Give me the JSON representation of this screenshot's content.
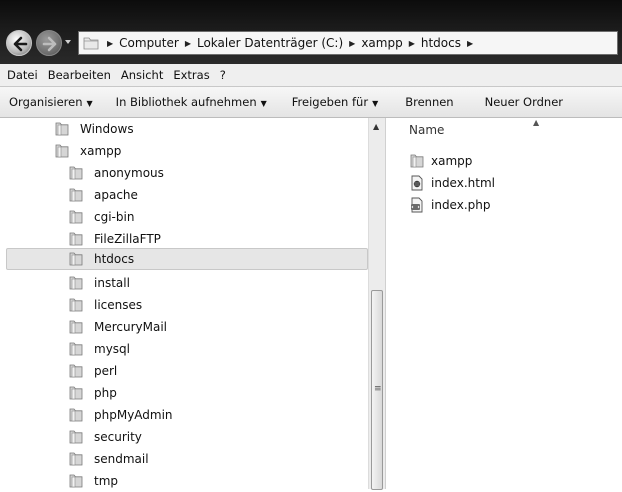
{
  "address_bar": {
    "crumbs": [
      "Computer",
      "Lokaler Datenträger (C:)",
      "xampp",
      "htdocs"
    ]
  },
  "menu": {
    "items": [
      "Datei",
      "Bearbeiten",
      "Ansicht",
      "Extras",
      "?"
    ]
  },
  "toolbar": {
    "organize": "Organisieren",
    "library": "In Bibliothek aufnehmen",
    "share": "Freigeben für",
    "burn": "Brennen",
    "new_folder": "Neuer Ordner"
  },
  "nav_tree": {
    "items": [
      "Windows",
      "xampp",
      "anonymous",
      "apache",
      "cgi-bin",
      "FileZillaFTP",
      "htdocs",
      "install",
      "licenses",
      "MercuryMail",
      "mysql",
      "perl",
      "php",
      "phpMyAdmin",
      "security",
      "sendmail",
      "tmp"
    ],
    "selected": "htdocs"
  },
  "content": {
    "column_header": "Name",
    "files": [
      "xampp",
      "index.html",
      "index.php"
    ]
  },
  "icons": {
    "back": "back-arrow-icon",
    "forward": "forward-arrow-icon",
    "folder": "folder-icon",
    "html_file": "html-file-icon",
    "php_file": "php-file-icon"
  }
}
